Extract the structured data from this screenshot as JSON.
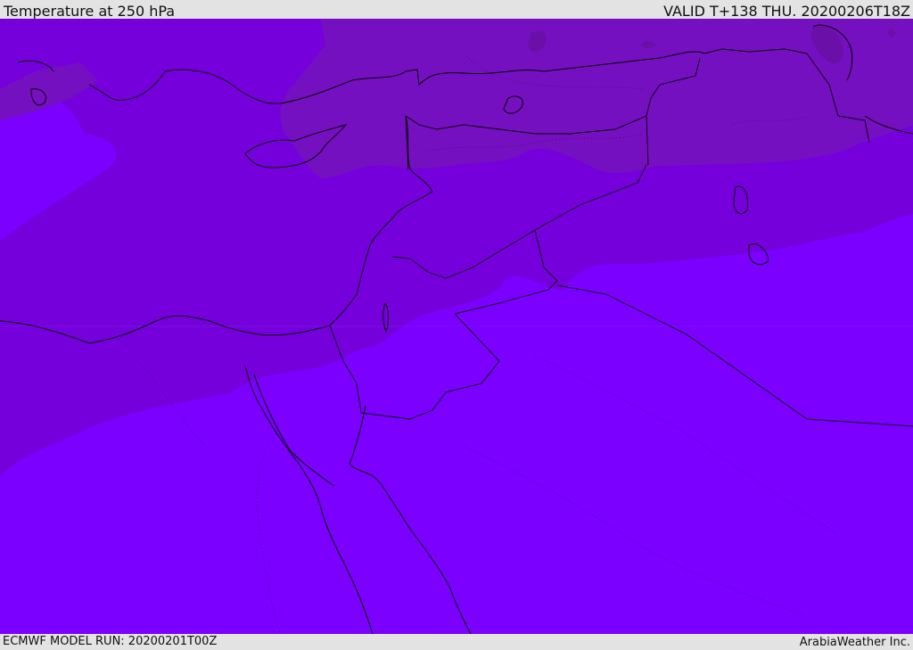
{
  "header": {
    "title": "Temperature at 250 hPa",
    "valid": "VALID T+138 THU. 20200206T18Z"
  },
  "footer": {
    "model_run": "ECMWF MODEL RUN: 20200201T00Z",
    "credit": "ArabiaWeather Inc."
  },
  "map": {
    "field": "temperature",
    "level": "250 hPa",
    "colors": {
      "warmest_band": "#7b00ff",
      "mid_band": "#7600dc",
      "cold_band": "#7510c0",
      "coldest_spot": "#6a10a8",
      "coastline": "#000000"
    }
  }
}
